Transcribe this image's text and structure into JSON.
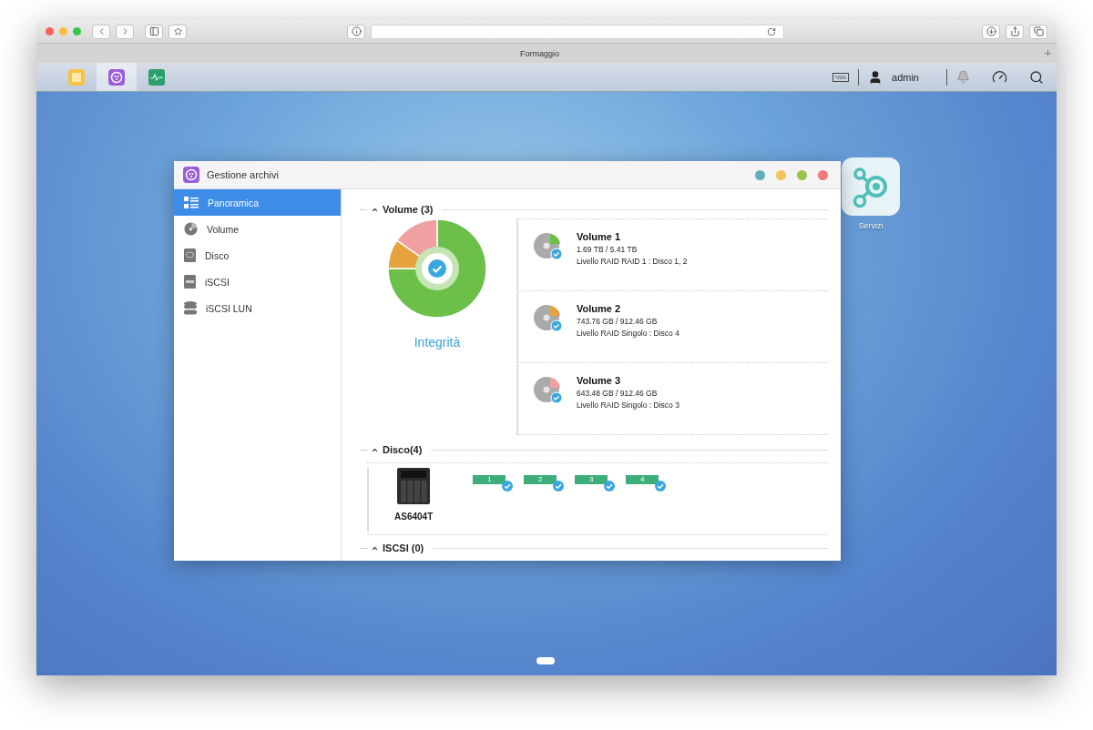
{
  "browser": {
    "tab_title": "Formaggio"
  },
  "taskbar": {
    "apps": [
      {
        "kind": "notes",
        "selected": false
      },
      {
        "kind": "storage",
        "selected": true
      },
      {
        "kind": "monitor",
        "selected": false
      }
    ],
    "user": "admin"
  },
  "desktop_icons": [
    {
      "label": "Servizi"
    }
  ],
  "window": {
    "title": "Gestione archivi",
    "controls": [
      {
        "color": "#5fb0b7"
      },
      {
        "color": "#f2c45a"
      },
      {
        "color": "#9bc24a"
      },
      {
        "color": "#ee7b7b"
      }
    ]
  },
  "sidebar": {
    "items": [
      {
        "kind": "overview",
        "label": "Panoramica",
        "selected": true
      },
      {
        "kind": "volume",
        "label": "Volume",
        "selected": false
      },
      {
        "kind": "disk",
        "label": "Disco",
        "selected": false
      },
      {
        "kind": "iscsi",
        "label": "iSCSI",
        "selected": false
      },
      {
        "kind": "lun",
        "label": "iSCSI LUN",
        "selected": false
      }
    ]
  },
  "volume_section": {
    "title": "Volume (3)",
    "expanded": true,
    "status": "Integrità",
    "volumes": [
      {
        "name": "Volume 1",
        "usage": "1.69 TB / 5.41 TB",
        "raid": "Livello RAID RAID 1 : Disco 1, 2",
        "color": "#6cc04a"
      },
      {
        "name": "Volume 2",
        "usage": "743.76 GB / 912.46 GB",
        "raid": "Livello RAID Singolo : Disco 4",
        "color": "#e6a23c"
      },
      {
        "name": "Volume 3",
        "usage": "643.48 GB / 912.46 GB",
        "raid": "Livello RAID Singolo : Disco 3",
        "color": "#f0a0a0"
      }
    ]
  },
  "disk_section": {
    "title": "Disco(4)",
    "expanded": true,
    "device": "AS6404T",
    "disks": [
      "1",
      "2",
      "3",
      "4"
    ]
  },
  "iscsi_section": {
    "title": "ISCSI (0)",
    "expanded": true
  }
}
